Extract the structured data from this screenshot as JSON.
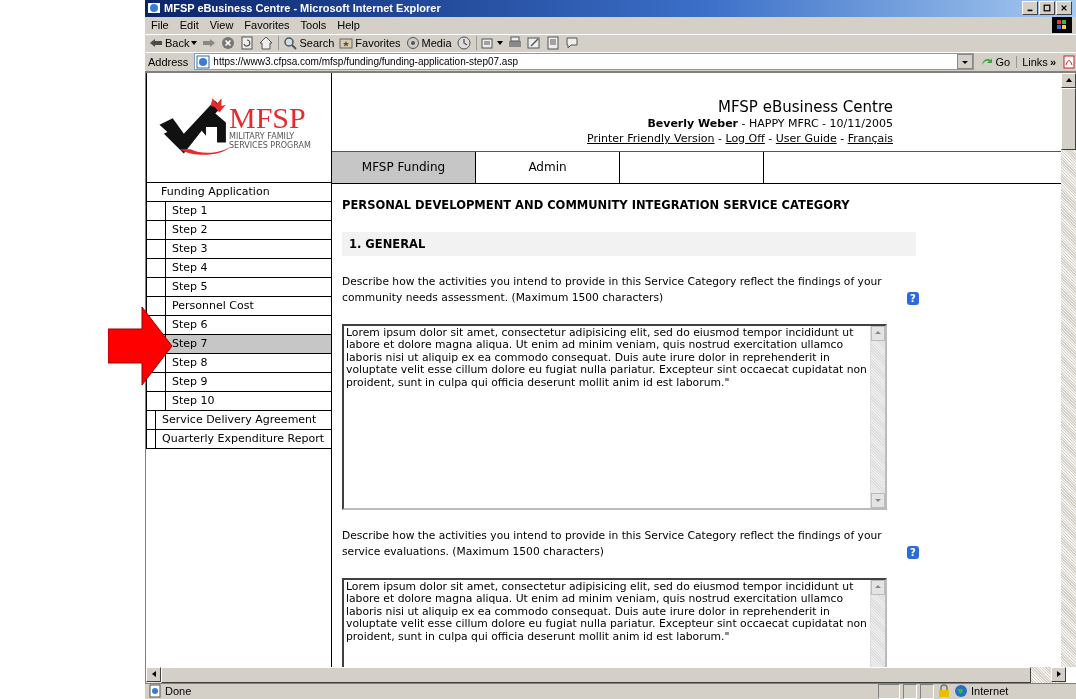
{
  "window": {
    "title": "MFSP eBusiness Centre - Microsoft Internet Explorer"
  },
  "menu": [
    "File",
    "Edit",
    "View",
    "Favorites",
    "Tools",
    "Help"
  ],
  "toolbar": [
    {
      "kind": "back",
      "label": "Back"
    },
    {
      "kind": "forward"
    },
    {
      "kind": "stop"
    },
    {
      "kind": "refresh"
    },
    {
      "kind": "home"
    },
    {
      "kind": "search",
      "label": "Search"
    },
    {
      "kind": "favorites",
      "label": "Favorites"
    },
    {
      "kind": "media",
      "label": "Media"
    },
    {
      "kind": "history"
    },
    {
      "kind": "mail"
    },
    {
      "kind": "print"
    },
    {
      "kind": "edit"
    },
    {
      "kind": "discuss"
    },
    {
      "kind": "messenger"
    }
  ],
  "address": {
    "label": "Address",
    "value": "https://www3.cfpsa.com/mfsp/funding/funding-application-step07.asp",
    "go": "Go",
    "links": "Links",
    "more": "»"
  },
  "logo": {
    "name": "MFSP",
    "line1": "MILITARY FAMILY",
    "line2": "SERVICES PROGRAM"
  },
  "header": {
    "site_title": "MFSP eBusiness Centre",
    "user": "Beverly Weber",
    "details": " - HAPPY MFRC - 10/11/2005",
    "links": [
      "Printer Friendly Version",
      "Log Off",
      "User Guide",
      "Français"
    ],
    "separator": " - "
  },
  "tabs": [
    {
      "label": "MFSP Funding",
      "selected": true
    },
    {
      "label": "Admin",
      "selected": false
    }
  ],
  "sidebar": {
    "items": [
      {
        "label": "Funding Application",
        "selected": false,
        "children": [
          {
            "label": "Step 1",
            "selected": false
          },
          {
            "label": "Step 2",
            "selected": false
          },
          {
            "label": "Step 3",
            "selected": false
          },
          {
            "label": "Step 4",
            "selected": false
          },
          {
            "label": "Step 5",
            "selected": false
          },
          {
            "label": "Personnel Cost",
            "selected": false
          },
          {
            "label": "Step 6",
            "selected": false
          },
          {
            "label": "Step 7",
            "selected": true
          },
          {
            "label": "Step 8",
            "selected": false
          },
          {
            "label": "Step 9",
            "selected": false
          },
          {
            "label": "Step 10",
            "selected": false
          }
        ]
      },
      {
        "label": "Service Delivery Agreement",
        "selected": false
      },
      {
        "label": "Quarterly Expenditure Report",
        "selected": false
      }
    ]
  },
  "page": {
    "heading": "PERSONAL DEVELOPMENT AND COMMUNITY INTEGRATION SERVICE CATEGORY",
    "section": "1. GENERAL",
    "questions": [
      {
        "prompt": "Describe how the activities you intend to provide in this Service Category reflect the findings of your community needs assessment. (Maximum 1500 characters)",
        "help": "?",
        "value": "Lorem ipsum dolor sit amet, consectetur adipisicing elit, sed do eiusmod tempor incididunt ut labore et dolore magna aliqua. Ut enim ad minim veniam, quis nostrud exercitation ullamco laboris nisi ut aliquip ex ea commodo consequat. Duis aute irure dolor in reprehenderit in voluptate velit esse cillum dolore eu fugiat nulla pariatur. Excepteur sint occaecat cupidatat non proident, sunt in culpa qui officia deserunt mollit anim id est laborum.\""
      },
      {
        "prompt": "Describe how the activities you intend to provide in this Service Category reflect the findings of your service evaluations. (Maximum 1500 characters)",
        "help": "?",
        "value": "Lorem ipsum dolor sit amet, consectetur adipisicing elit, sed do eiusmod tempor incididunt ut labore et dolore magna aliqua. Ut enim ad minim veniam, quis nostrud exercitation ullamco laboris nisi ut aliquip ex ea commodo consequat. Duis aute irure dolor in reprehenderit in voluptate velit esse cillum dolore eu fugiat nulla pariatur. Excepteur sint occaecat cupidatat non proident, sunt in culpa qui officia deserunt mollit anim id est laborum.\""
      }
    ]
  },
  "status_bar": {
    "text": "Done",
    "zone": "Internet"
  },
  "annotation": {
    "kind": "arrow"
  }
}
